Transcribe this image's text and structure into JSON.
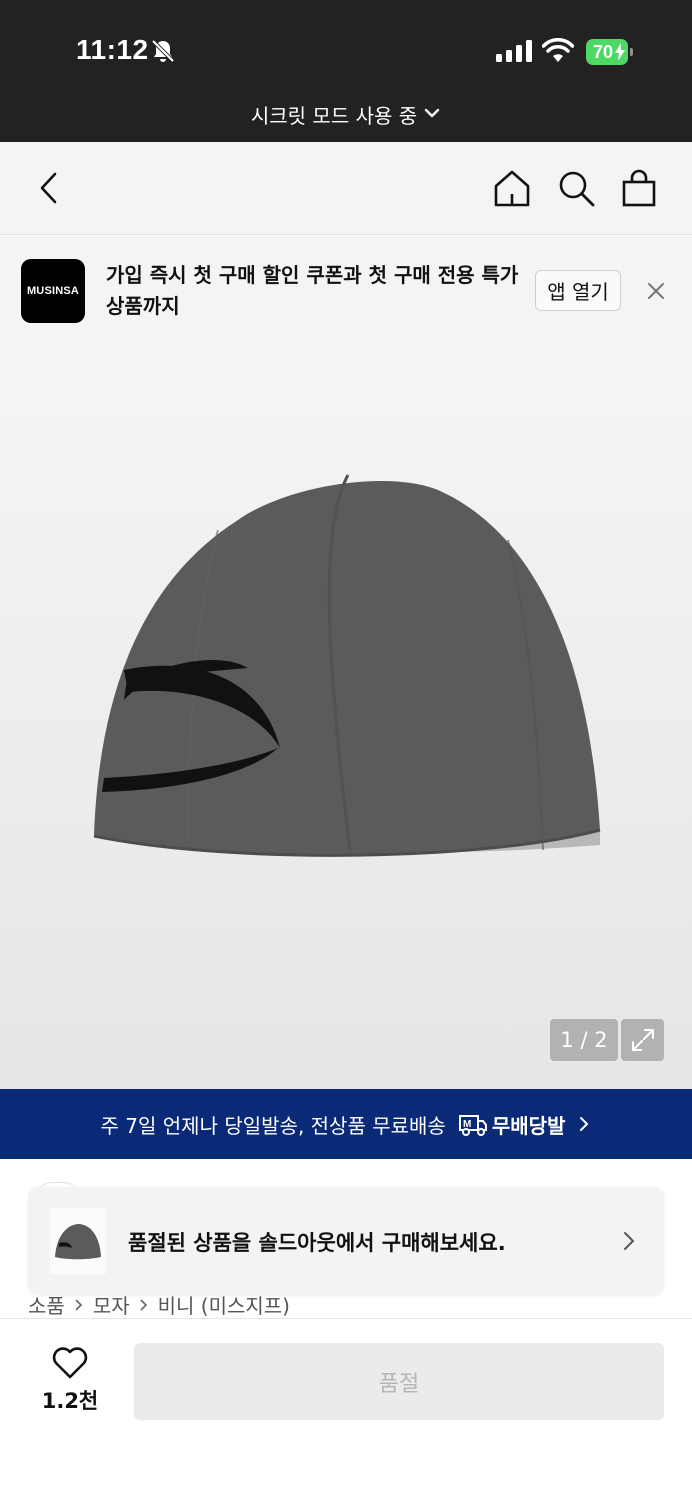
{
  "status_bar": {
    "time": "11:12",
    "battery": "70",
    "battery_color": "#4cd964"
  },
  "incognito": {
    "label": "시크릿 모드 사용 중"
  },
  "nav": {
    "icons": [
      "back-icon",
      "home-icon",
      "search-icon",
      "bag-icon"
    ]
  },
  "promo": {
    "logo": "MUSINSA",
    "text": "가입 즉시 첫 구매 할인 쿠폰과 첫 구매 전용 특가 상품까지",
    "open_label": "앱 열기"
  },
  "gallery": {
    "pager": "1 / 2"
  },
  "shipping": {
    "text": "주 7일 언제나 당일발송, 전상품 무료배송",
    "badge": "무배당발",
    "color": "#0a2a77"
  },
  "soldout_notice": {
    "text": "품절된 상품을 솔드아웃에서 구매해보세요."
  },
  "breadcrumb": [
    "소품",
    "모자",
    "비니 (미스지프)"
  ],
  "bottom": {
    "like_count": "1.2천",
    "buy_label": "품절"
  }
}
